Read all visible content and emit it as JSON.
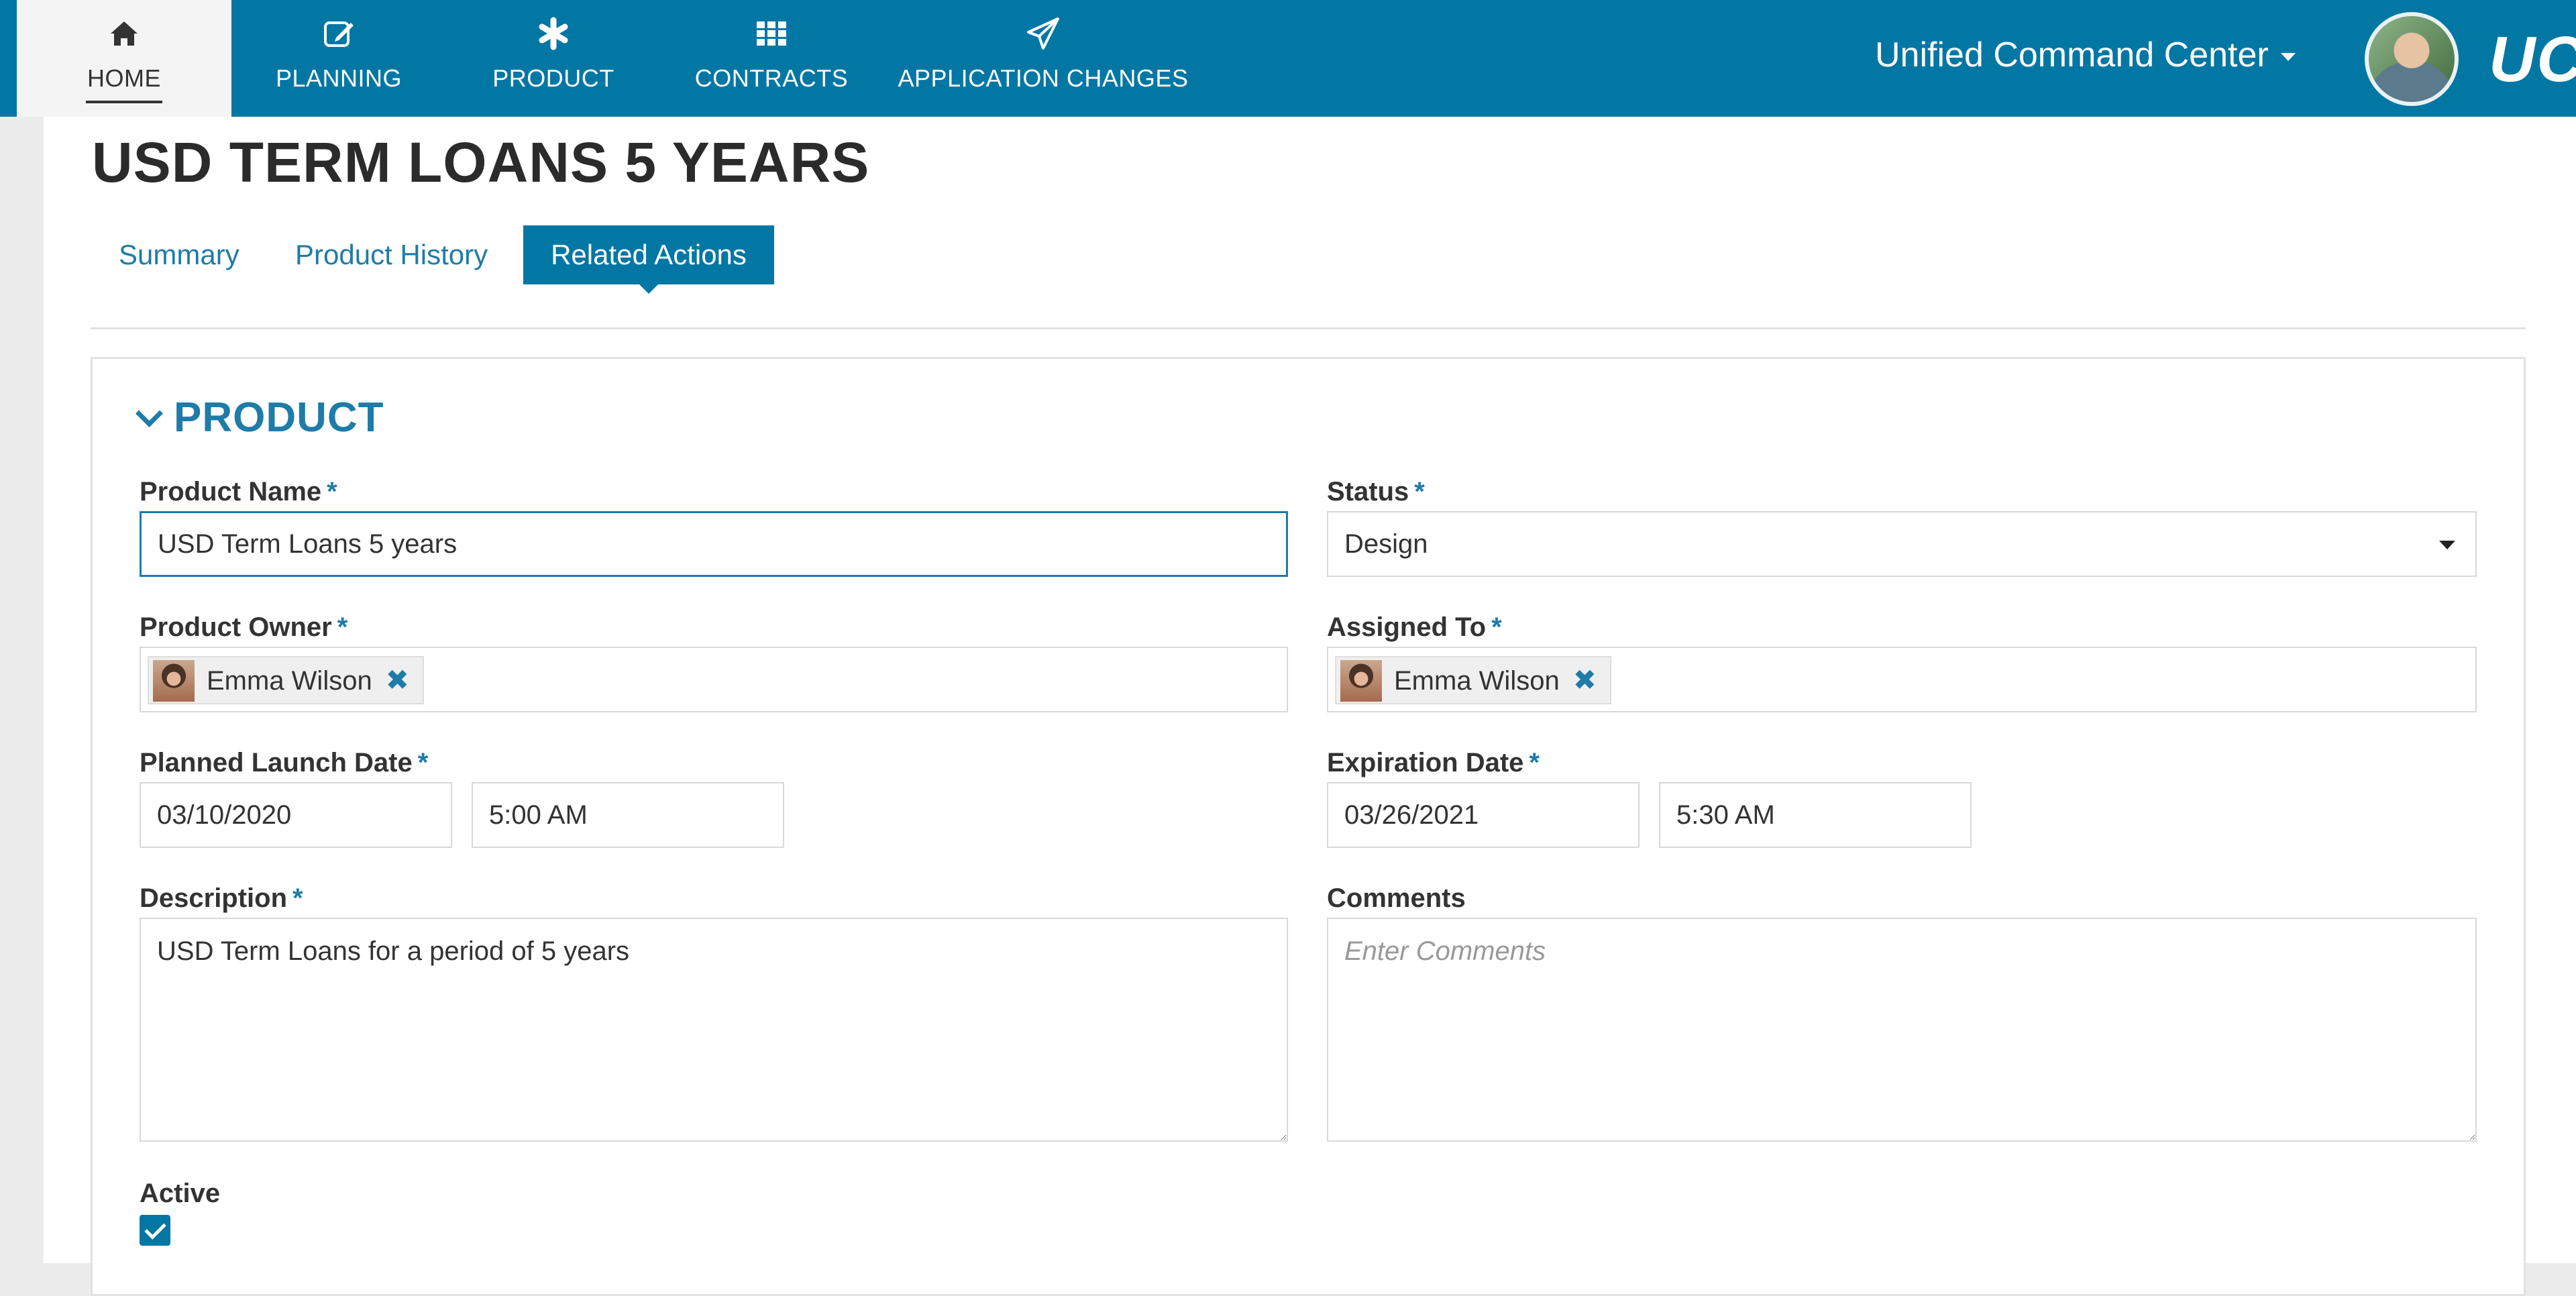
{
  "nav": {
    "items": [
      {
        "label": "HOME",
        "icon": "home-icon"
      },
      {
        "label": "PLANNING",
        "icon": "edit-icon"
      },
      {
        "label": "PRODUCT",
        "icon": "asterisk-icon"
      },
      {
        "label": "CONTRACTS",
        "icon": "grid-icon"
      },
      {
        "label": "APPLICATION CHANGES",
        "icon": "paper-plane-icon"
      }
    ],
    "active": "HOME",
    "center_selector": "Unified Command Center",
    "brand": "UC"
  },
  "page": {
    "title": "USD TERM LOANS 5 YEARS",
    "tabs": [
      {
        "label": "Summary",
        "active": false
      },
      {
        "label": "Product History",
        "active": false
      },
      {
        "label": "Related Actions",
        "active": true
      }
    ]
  },
  "section": {
    "title": "PRODUCT"
  },
  "form": {
    "product_name": {
      "label": "Product Name",
      "required": "*",
      "value": "USD Term Loans 5 years"
    },
    "status": {
      "label": "Status",
      "required": "*",
      "value": "Design"
    },
    "product_owner": {
      "label": "Product Owner",
      "required": "*",
      "person": "Emma Wilson"
    },
    "assigned_to": {
      "label": "Assigned To",
      "required": "*",
      "person": "Emma Wilson"
    },
    "planned_launch": {
      "label": "Planned Launch Date",
      "required": "*",
      "date": "03/10/2020",
      "time": "5:00 AM"
    },
    "expiration": {
      "label": "Expiration Date",
      "required": "*",
      "date": "03/26/2021",
      "time": "5:30 AM"
    },
    "description": {
      "label": "Description",
      "required": "*",
      "value": "USD Term Loans for a period of 5 years"
    },
    "comments": {
      "label": "Comments",
      "placeholder": "Enter Comments"
    },
    "active": {
      "label": "Active",
      "checked": true
    }
  },
  "colors": {
    "primary": "#0277a4",
    "accent": "#1f7ba8"
  }
}
